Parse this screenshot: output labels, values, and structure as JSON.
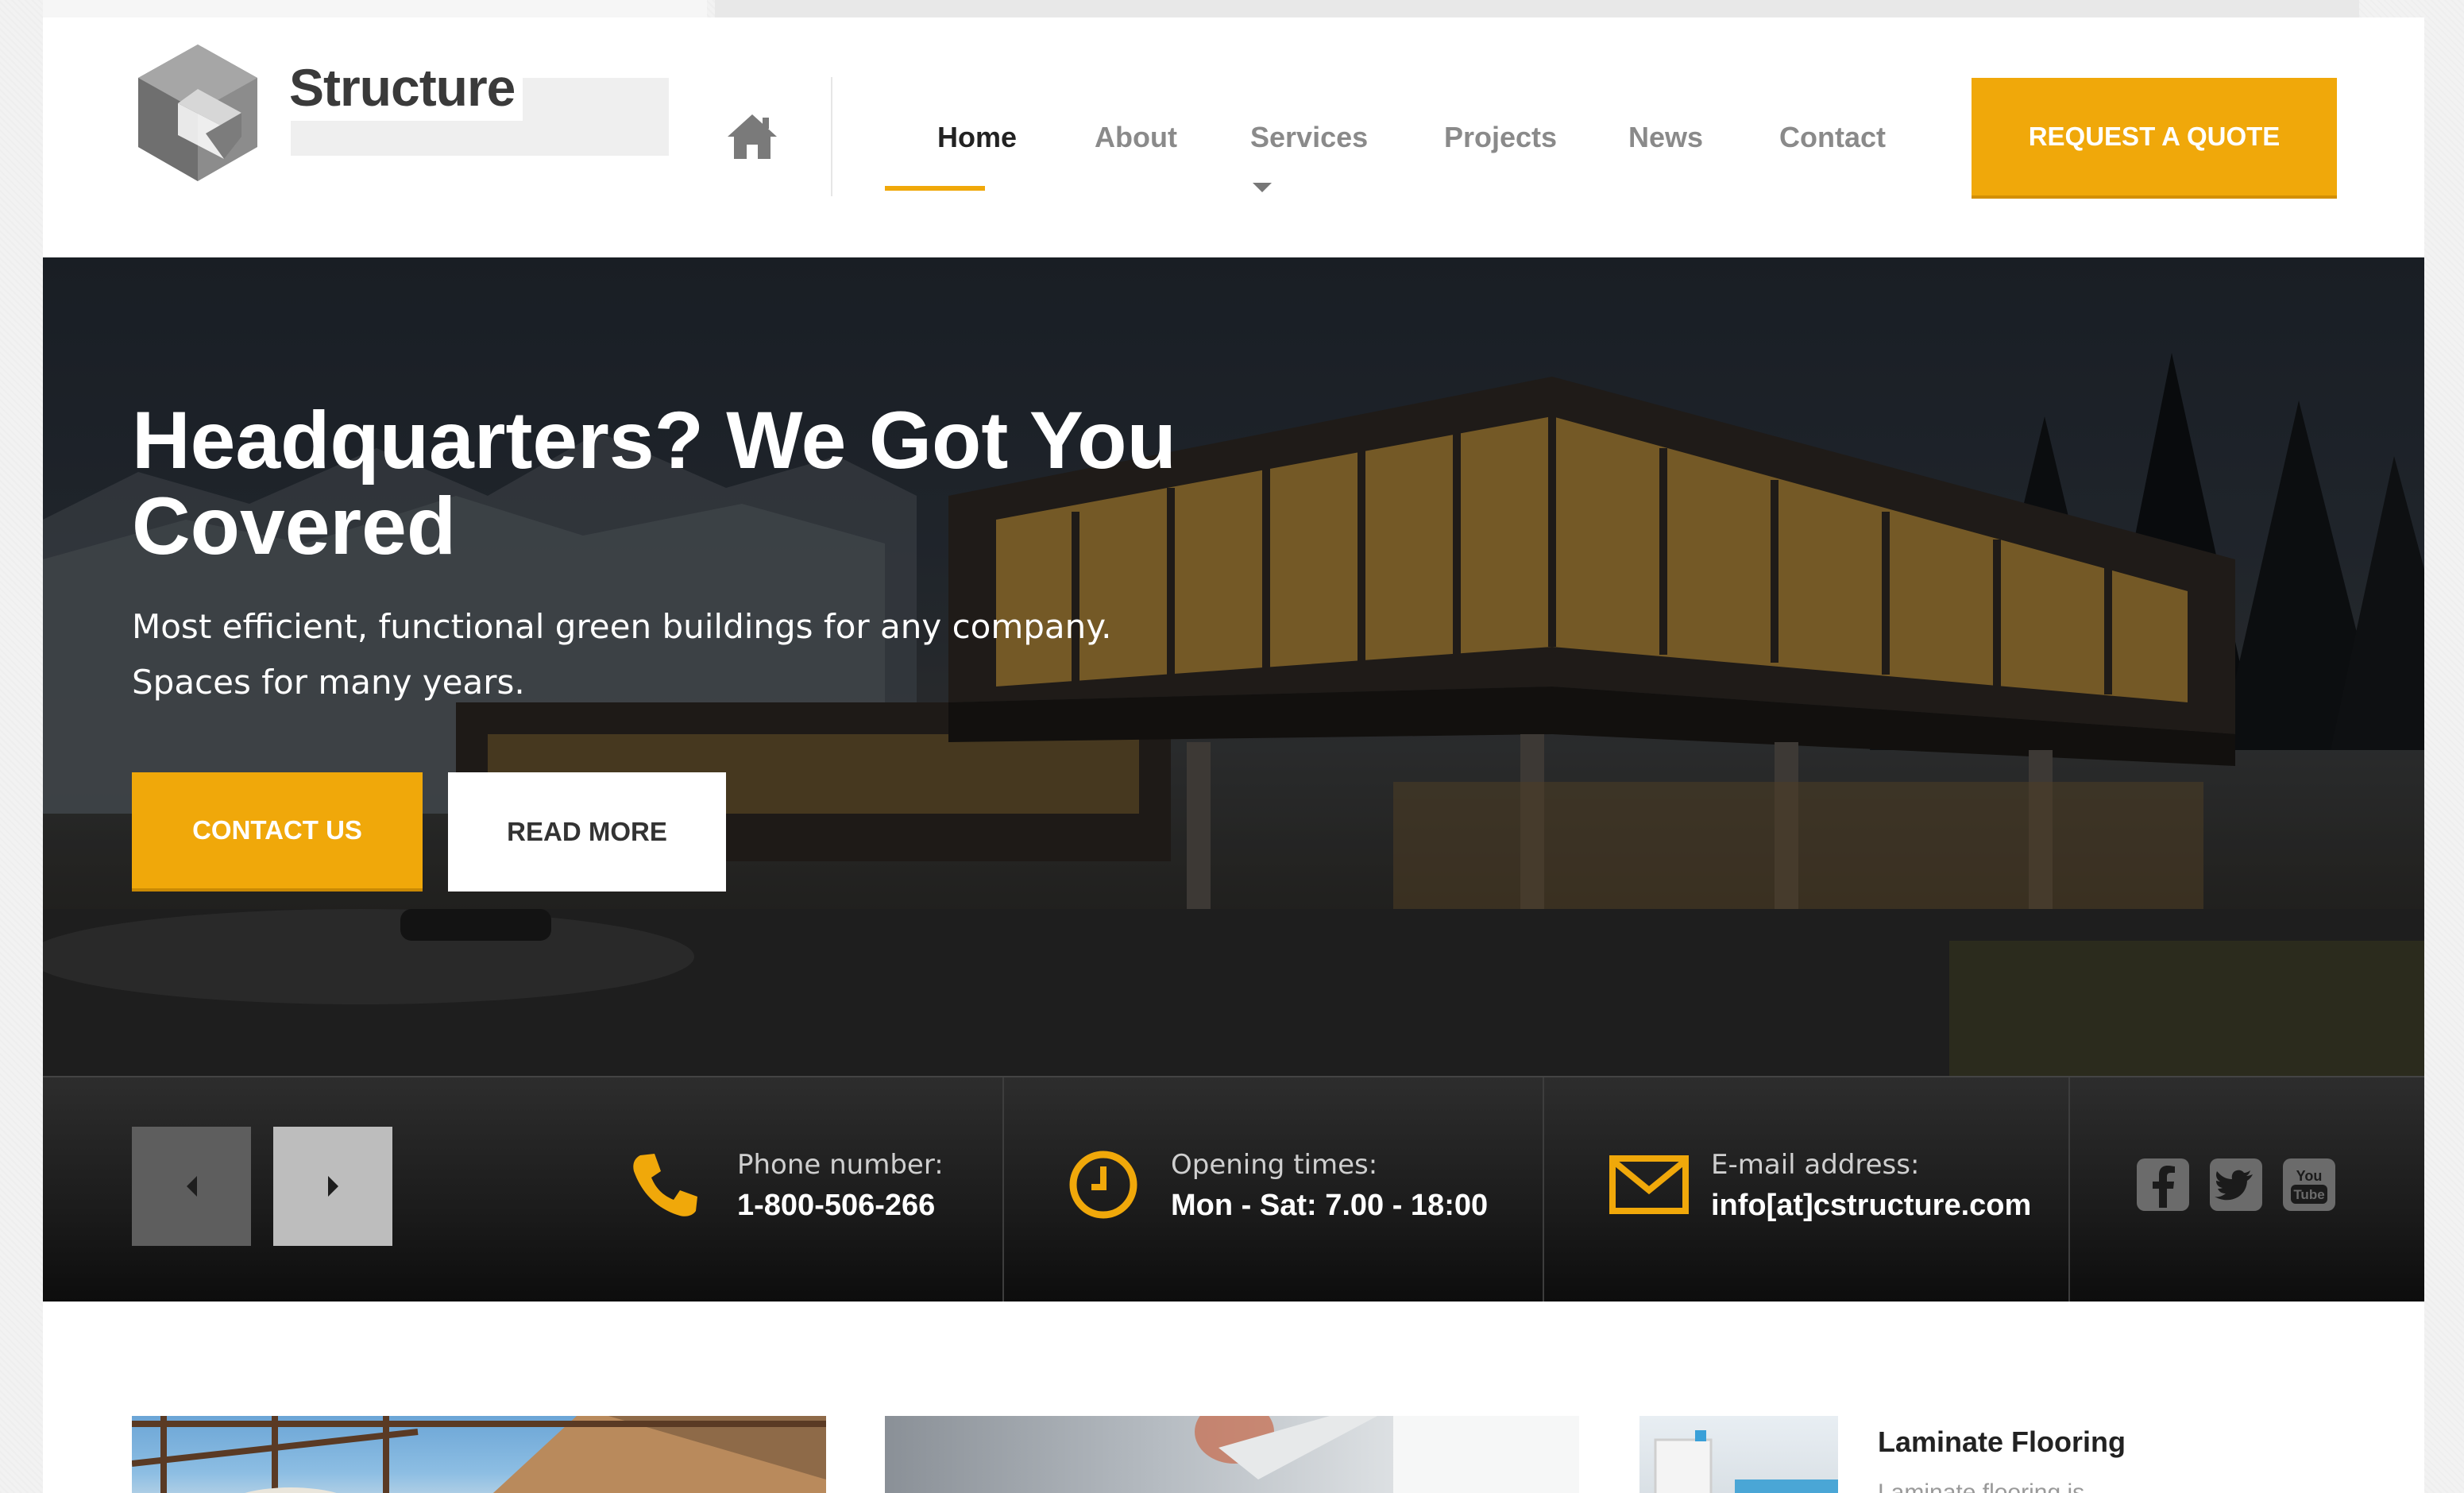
{
  "brand": {
    "name": "Structure"
  },
  "nav": {
    "items": [
      {
        "label": "Home",
        "active": true
      },
      {
        "label": "About"
      },
      {
        "label": "Services",
        "has_dropdown": true
      },
      {
        "label": "Projects"
      },
      {
        "label": "News"
      },
      {
        "label": "Contact"
      }
    ],
    "quote_button": "REQUEST A QUOTE"
  },
  "hero": {
    "title": "Headquarters? We Got You Covered",
    "subtitle": "Most efficient, functional green buildings for any company. Spaces for many years.",
    "contact_button": "CONTACT US",
    "read_more_button": "READ MORE"
  },
  "info": {
    "phone": {
      "label": "Phone number:",
      "value": "1-800-506-266",
      "icon": "phone-icon"
    },
    "hours": {
      "label": "Opening times:",
      "value": "Mon - Sat: 7.00 - 18:00",
      "icon": "clock-icon"
    },
    "email": {
      "label": "E-mail address:",
      "value": "info[at]cstructure.com",
      "icon": "mail-icon"
    },
    "social": [
      "facebook-icon",
      "twitter-icon",
      "youtube-icon"
    ],
    "youtube_logo": {
      "line1": "You",
      "line2": "Tube"
    }
  },
  "cards": {
    "side_title": "Laminate Flooring",
    "side_text": "Laminate flooring is..."
  },
  "colors": {
    "accent": "#f0a80a",
    "dark": "#1b1b1b",
    "nav_text": "#8a8a8a"
  }
}
